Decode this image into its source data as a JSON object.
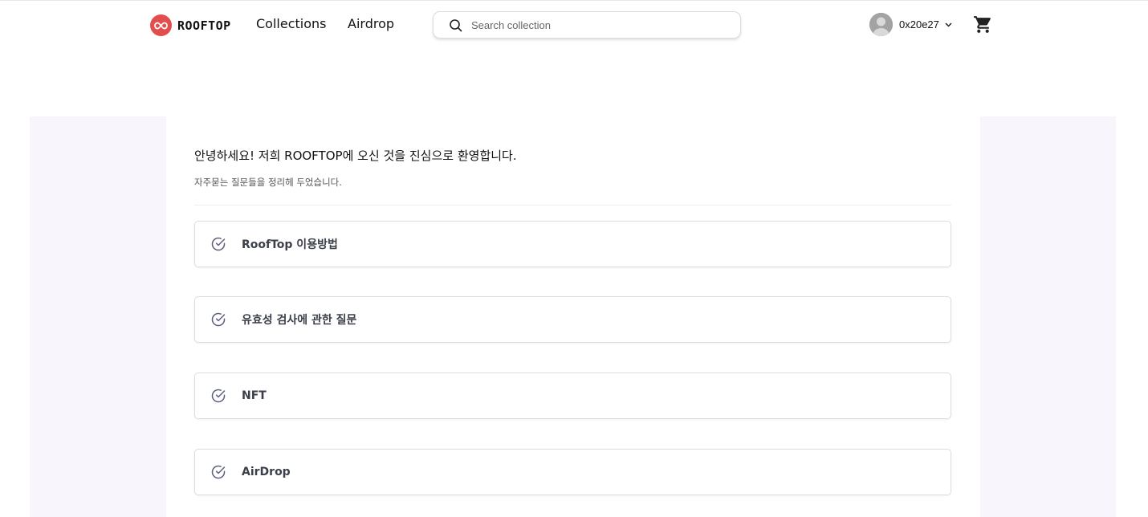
{
  "header": {
    "brand": "ROOFTOP",
    "nav": {
      "collections": "Collections",
      "airdrop": "Airdrop"
    },
    "search": {
      "placeholder": "Search collection",
      "value": ""
    },
    "account": {
      "wallet": "0x20e27"
    }
  },
  "main": {
    "welcome": "안녕하세요! 저희 ROOFTOP에 오신 것을 진심으로 환영합니다.",
    "subtitle": "자주묻는 질문들을 정리헤 두었습니다.",
    "faq": [
      {
        "label": "RoofTop 이용방법"
      },
      {
        "label": "유효성 검사에 관한 질문"
      },
      {
        "label": "NFT"
      },
      {
        "label": "AirDrop"
      }
    ]
  },
  "colors": {
    "brand": "#e44d4d",
    "page_bg": "#f9f5fd",
    "check": "#5a5f7d"
  },
  "icons": [
    "logo-icon",
    "search-icon",
    "avatar-icon",
    "chevron-down-icon",
    "cart-icon",
    "check-circle-icon"
  ]
}
